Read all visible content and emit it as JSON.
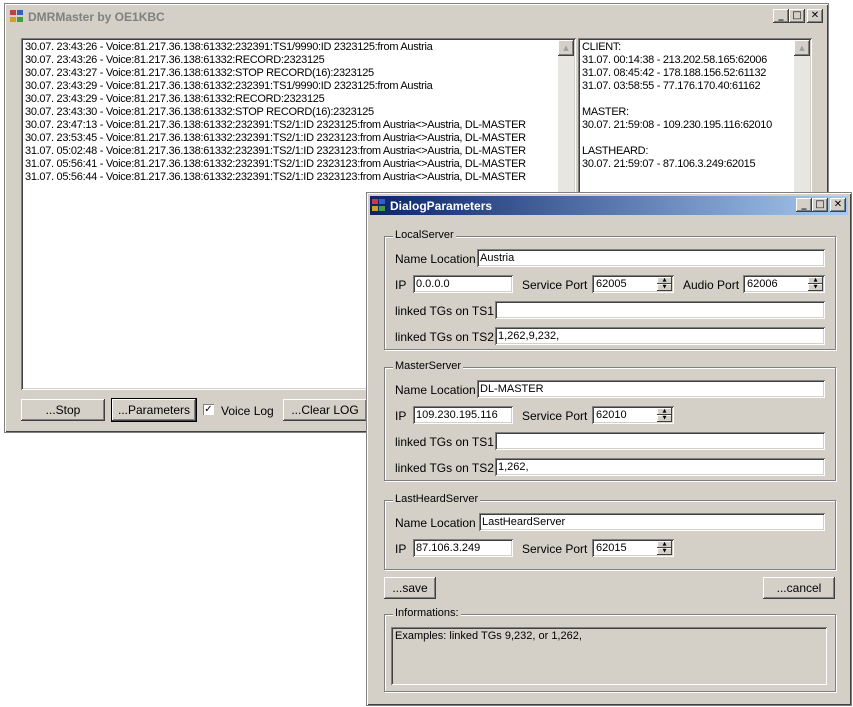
{
  "main": {
    "title": "DMRMaster by OE1KBC",
    "log_lines": [
      "30.07. 23:43:26 - Voice:81.217.36.138:61332:232391:TS1/9990:ID 2323125:from Austria",
      "30.07. 23:43:26 - Voice:81.217.36.138:61332:RECORD:2323125",
      "30.07. 23:43:27 - Voice:81.217.36.138:61332:STOP RECORD(16):2323125",
      "30.07. 23:43:29 - Voice:81.217.36.138:61332:232391:TS1/9990:ID 2323125:from Austria",
      "30.07. 23:43:29 - Voice:81.217.36.138:61332:RECORD:2323125",
      "30.07. 23:43:30 - Voice:81.217.36.138:61332:STOP RECORD(16):2323125",
      "30.07. 23:47:13 - Voice:81.217.36.138:61332:232391:TS2/1:ID 2323125:from Austria<>Austria, DL-MASTER",
      "30.07. 23:53:45 - Voice:81.217.36.138:61332:232391:TS2/1:ID 2323123:from Austria<>Austria, DL-MASTER",
      "31.07. 05:02:48 - Voice:81.217.36.138:61332:232391:TS2/1:ID 2323123:from Austria<>Austria, DL-MASTER",
      "31.07. 05:56:41 - Voice:81.217.36.138:61332:232391:TS2/1:ID 2323123:from Austria<>Austria, DL-MASTER",
      "31.07. 05:56:44 - Voice:81.217.36.138:61332:232391:TS2/1:ID 2323123:from Austria<>Austria, DL-MASTER"
    ],
    "status_lines": [
      "CLIENT:",
      "31.07. 00:14:38 - 213.202.58.165:62006",
      "31.07. 08:45:42 - 178.188.156.52:61132",
      "31.07. 03:58:55 - 77.176.170.40:61162",
      "",
      "MASTER:",
      "30.07. 21:59:08 - 109.230.195.116:62010",
      "",
      "LASTHEARD:",
      "30.07. 21:59:07 - 87.106.3.249:62015"
    ],
    "stop_label": "...Stop",
    "parameters_label": "...Parameters",
    "voice_log_label": "Voice Log",
    "voice_log_checked": true,
    "clear_log_label": "...Clear LOG"
  },
  "dialog": {
    "title": "DialogParameters",
    "local": {
      "legend": "LocalServer",
      "name_location_label": "Name Location",
      "name_location": "Austria",
      "ip_label": "IP",
      "ip": "0.0.0.0",
      "service_port_label": "Service Port",
      "service_port": "62005",
      "audio_port_label": "Audio Port",
      "audio_port": "62006",
      "ts1_label": "linked TGs on TS1",
      "ts1": "",
      "ts2_label": "linked TGs on TS2",
      "ts2": "1,262,9,232,"
    },
    "master": {
      "legend": "MasterServer",
      "name_location_label": "Name Location",
      "name_location": "DL-MASTER",
      "ip_label": "IP",
      "ip": "109.230.195.116",
      "service_port_label": "Service Port",
      "service_port": "62010",
      "ts1_label": "linked TGs on TS1",
      "ts1": "",
      "ts2_label": "linked TGs on TS2",
      "ts2": "1,262,"
    },
    "lastheard": {
      "legend": "LastHeardServer",
      "name_location_label": "Name Location",
      "name_location": "LastHeardServer",
      "ip_label": "IP",
      "ip": "87.106.3.249",
      "service_port_label": "Service Port",
      "service_port": "62015"
    },
    "save_label": "...save",
    "cancel_label": "...cancel",
    "info_legend": "Informations:",
    "info_text": "Examples: linked TGs  9,232,  or  1,262,"
  },
  "icons": {
    "minimize": "minimize-icon",
    "maximize": "maximize-icon",
    "close": "close-icon",
    "app": "app-icon"
  }
}
